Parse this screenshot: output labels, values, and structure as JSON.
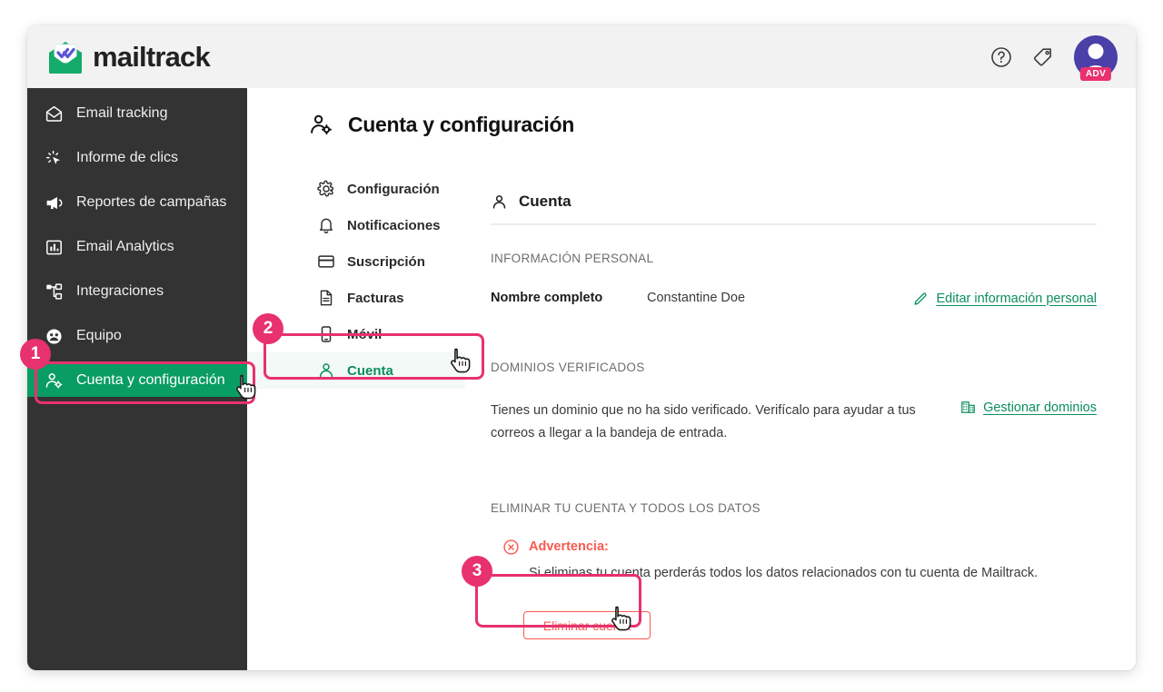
{
  "header": {
    "brand_name": "mailtrack",
    "logo_icon": "mailtrack-envelope-logo",
    "help_icon": "help-circle-icon",
    "pricing_icon": "price-tag-icon",
    "avatar_icon": "user-avatar",
    "avatar_badge": "ADV"
  },
  "sidebar": {
    "items": [
      {
        "label": "Email tracking",
        "icon": "envelope-icon",
        "active": false
      },
      {
        "label": "Informe de clics",
        "icon": "click-cursor-icon",
        "active": false
      },
      {
        "label": "Reportes de campañas",
        "icon": "megaphone-icon",
        "active": false
      },
      {
        "label": "Email Analytics",
        "icon": "bar-chart-icon",
        "active": false
      },
      {
        "label": "Integraciones",
        "icon": "nodes-icon",
        "active": false
      },
      {
        "label": "Equipo",
        "icon": "people-icon",
        "active": false
      },
      {
        "label": "Cuenta y configuración",
        "icon": "user-gear-icon",
        "active": true
      }
    ]
  },
  "submenu": {
    "items": [
      {
        "label": "Configuración",
        "icon": "gear-icon",
        "active": false
      },
      {
        "label": "Notificaciones",
        "icon": "bell-icon",
        "active": false
      },
      {
        "label": "Suscripción",
        "icon": "credit-card-icon",
        "active": false
      },
      {
        "label": "Facturas",
        "icon": "document-icon",
        "active": false
      },
      {
        "label": "Móvil",
        "icon": "mobile-phone-icon",
        "active": false
      },
      {
        "label": "Cuenta",
        "icon": "user-icon",
        "active": true
      }
    ]
  },
  "main": {
    "page_title": "Cuenta y configuración",
    "page_title_icon": "user-gear-icon",
    "section_title": "Cuenta",
    "section_icon": "user-icon",
    "personal": {
      "group_label": "INFORMACIÓN PERSONAL",
      "field_name": "Nombre completo",
      "field_value": "Constantine Doe",
      "link_text": "Editar información personal",
      "link_icon": "pencil-icon"
    },
    "domains": {
      "group_label": "DOMINIOS VERIFICADOS",
      "body_text": "Tienes un dominio que no ha sido verificado. Verifícalo para ayudar a tus correos a llegar a la bandeja de entrada.",
      "link_text": "Gestionar dominios",
      "link_icon": "building-grid-icon"
    },
    "delete": {
      "group_label": "ELIMINAR TU CUENTA Y TODOS LOS DATOS",
      "warning_icon": "error-circle-x-icon",
      "warning_title": "Advertencia:",
      "warning_text": "Si eliminas tu cuenta perderás todos los datos relacionados con tu cuenta de Mailtrack.",
      "button_label": "Eliminar cuenta"
    }
  },
  "annotations": {
    "steps": [
      {
        "number": "1",
        "target": "sidebar-item-cuenta-y-configuracion"
      },
      {
        "number": "2",
        "target": "submenu-item-cuenta"
      },
      {
        "number": "3",
        "target": "delete-account-button"
      }
    ],
    "accent_color": "#e8316f"
  },
  "colors": {
    "sidebar_bg": "#333333",
    "sidebar_active": "#0a9d63",
    "brand_green": "#0a8f5c",
    "danger": "#fa5a50",
    "accent_pink": "#e8316f",
    "avatar_purple": "#4b3fa8",
    "header_bg": "#f2f2f2"
  }
}
